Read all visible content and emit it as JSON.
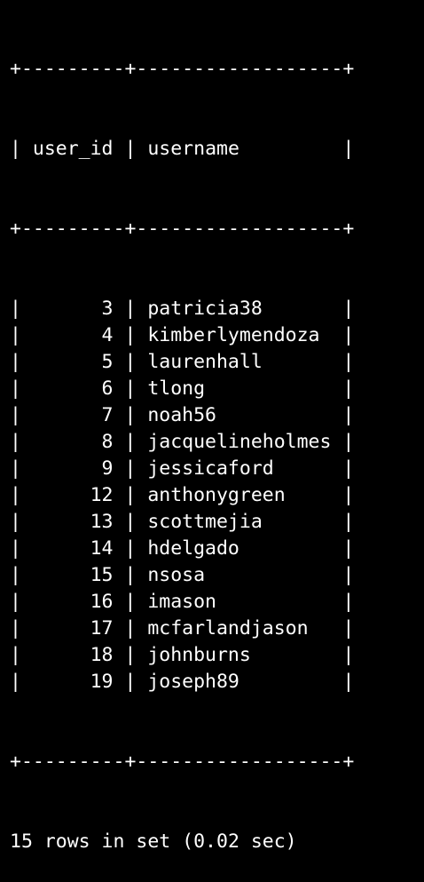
{
  "table": {
    "columns": [
      "user_id",
      "username"
    ],
    "rows": [
      {
        "user_id": "3",
        "username": "patricia38"
      },
      {
        "user_id": "4",
        "username": "kimberlymendoza"
      },
      {
        "user_id": "5",
        "username": "laurenhall"
      },
      {
        "user_id": "6",
        "username": "tlong"
      },
      {
        "user_id": "7",
        "username": "noah56"
      },
      {
        "user_id": "8",
        "username": "jacquelineholmes"
      },
      {
        "user_id": "9",
        "username": "jessicaford"
      },
      {
        "user_id": "12",
        "username": "anthonygreen"
      },
      {
        "user_id": "13",
        "username": "scottmejia"
      },
      {
        "user_id": "14",
        "username": "hdelgado"
      },
      {
        "user_id": "15",
        "username": "nsosa"
      },
      {
        "user_id": "16",
        "username": "imason"
      },
      {
        "user_id": "17",
        "username": "mcfarlandjason"
      },
      {
        "user_id": "18",
        "username": "johnburns"
      },
      {
        "user_id": "19",
        "username": "joseph89"
      }
    ]
  },
  "summary": "15 rows in set (0.02 sec)",
  "colors": {
    "background": "#000000",
    "text": "#ffffff"
  }
}
